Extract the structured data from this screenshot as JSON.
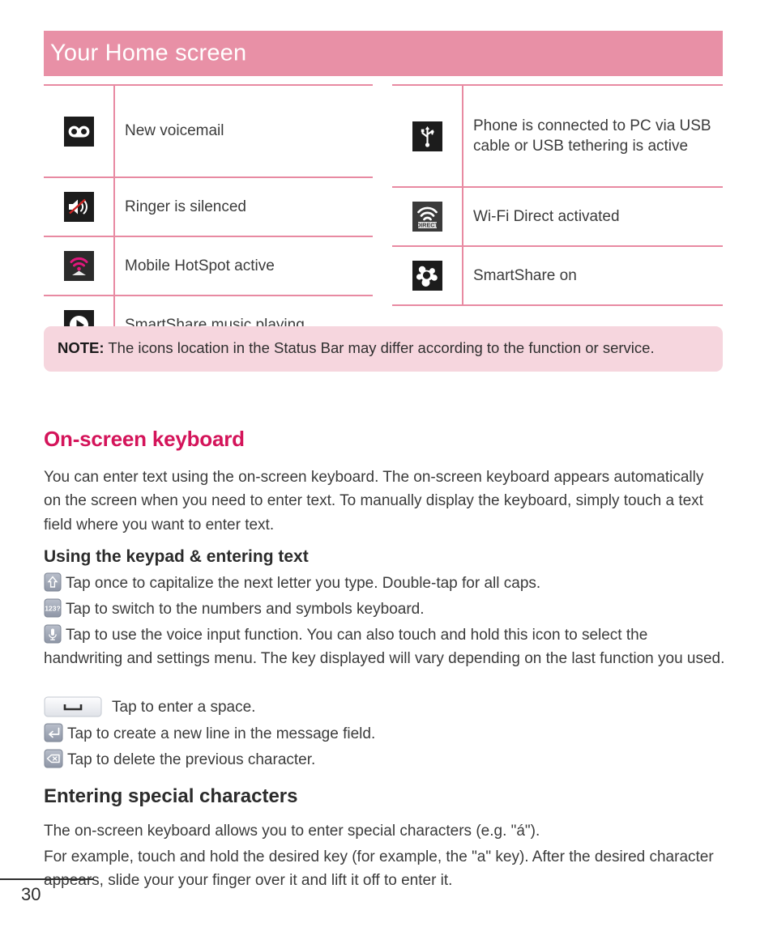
{
  "header": {
    "title": "Your Home screen",
    "bg_color": "#e890a6"
  },
  "status_icon_table": {
    "left_column": [
      {
        "icon": "voicemail-icon",
        "label": "New voicemail"
      },
      {
        "icon": "ringer-silenced-icon",
        "label": "Ringer is silenced"
      },
      {
        "icon": "mobile-hotspot-icon",
        "label": "Mobile HotSpot active"
      },
      {
        "icon": "smartshare-music-playing-icon",
        "label": "SmartShare music playing"
      }
    ],
    "right_column": [
      {
        "icon": "usb-icon",
        "label": "Phone is connected to PC via USB cable or USB tethering is active"
      },
      {
        "icon": "wifi-direct-icon",
        "label": "Wi-Fi Direct activated"
      },
      {
        "icon": "smartshare-icon",
        "label": "SmartShare on"
      }
    ]
  },
  "note": {
    "label": "NOTE:",
    "text": " The icons location in the Status Bar may differ according to the function or service.",
    "bg_color": "#f6d6de"
  },
  "sections": {
    "onscreen_keyboard": {
      "heading": "On-screen keyboard",
      "heading_color": "#d4145a",
      "paragraph": "You can enter text using the on-screen keyboard. The on-screen keyboard appears automatically on the screen when you need to enter text. To manually display the keyboard, simply touch a text field where you want to enter text."
    },
    "using_keypad": {
      "heading": "Using the keypad & entering text",
      "lines": [
        {
          "key": "shift-key-icon",
          "text": "Tap once to capitalize the next letter you type. Double-tap for all caps."
        },
        {
          "key": "numbers-symbols-key-icon",
          "text": "Tap to switch to the numbers and symbols keyboard."
        },
        {
          "key": "voice-input-key-icon",
          "text": "Tap to use the voice input function. You can also touch and hold this icon to select the handwriting and settings menu. The key displayed will vary depending on the last function you used."
        },
        {
          "key": "space-key-icon",
          "text": "Tap to enter a space."
        },
        {
          "key": "enter-key-icon",
          "text": "Tap to create a new line in the message field."
        },
        {
          "key": "delete-key-icon",
          "text": "Tap to delete the previous character."
        }
      ]
    },
    "special_characters": {
      "heading": "Entering special characters",
      "paragraph_1": "The on-screen keyboard allows you to enter special characters (e.g. \"á\").",
      "paragraph_2": "For example, touch and hold the desired key (for example, the \"a\" key). After the desired character appears, slide your your finger over it and lift it off to enter it."
    }
  },
  "footer": {
    "page_number": "30"
  }
}
